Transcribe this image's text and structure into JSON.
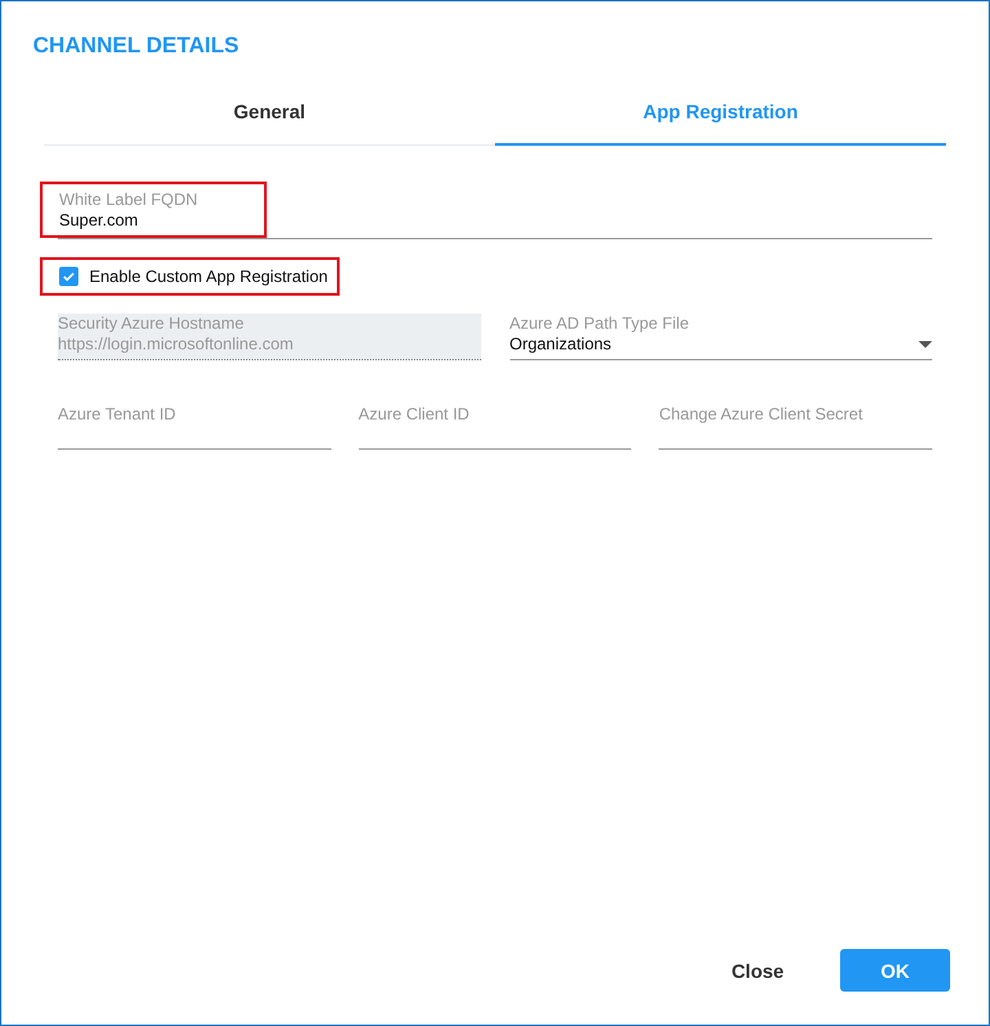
{
  "dialog": {
    "title": "CHANNEL DETAILS"
  },
  "tabs": [
    {
      "label": "General",
      "selected": false
    },
    {
      "label": "App Registration",
      "selected": true
    }
  ],
  "fqdn": {
    "label": "White Label FQDN",
    "value": "Super.com",
    "highlighted": true
  },
  "custom_registration": {
    "label": "Enable Custom App Registration",
    "checked": true,
    "highlighted": true
  },
  "hostname": {
    "label": "Security Azure Hostname",
    "value": "https://login.microsoftonline.com",
    "disabled": true
  },
  "path_type": {
    "label": "Azure AD Path Type File",
    "value": "Organizations"
  },
  "credentials": [
    {
      "label": "Azure Tenant ID"
    },
    {
      "label": "Azure Client ID"
    },
    {
      "label": "Change Azure Client Secret"
    }
  ],
  "buttons": [
    {
      "label": "Close",
      "kind": "text"
    },
    {
      "label": "OK",
      "kind": "primary"
    }
  ]
}
